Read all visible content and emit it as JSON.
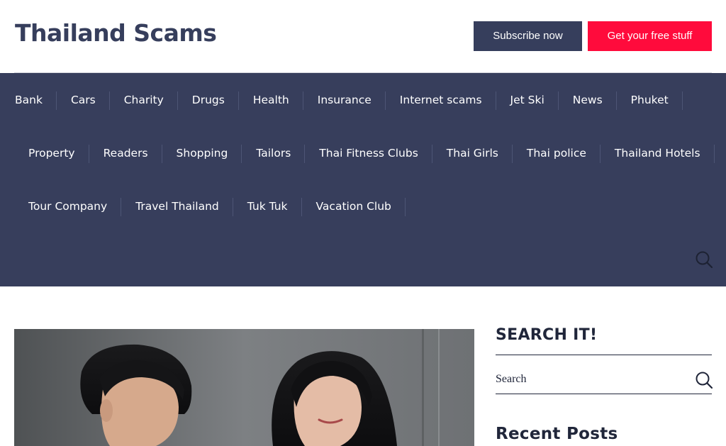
{
  "site": {
    "title": "Thailand Scams"
  },
  "header": {
    "subscribe_label": "Subscribe now",
    "free_label": "Get your free stuff"
  },
  "nav": {
    "rows": [
      [
        "Bank",
        "Cars",
        "Charity",
        "Drugs",
        "Health",
        "Insurance",
        "Internet scams",
        "Jet Ski",
        "News",
        "Phuket"
      ],
      [
        "Property",
        "Readers",
        "Shopping",
        "Tailors",
        "Thai Fitness Clubs",
        "Thai Girls",
        "Thai police",
        "Thailand Hotels"
      ],
      [
        "Tour Company",
        "Travel Thailand",
        "Tuk Tuk",
        "Vacation Club"
      ]
    ],
    "search_icon": "search-icon"
  },
  "sidebar": {
    "search_title": "SEARCH IT!",
    "search_placeholder": "Search",
    "recent_title": "Recent Posts"
  },
  "colors": {
    "nav_bg": "#373e5c",
    "subscribe_bg": "#363e5c",
    "free_bg": "#ff0b3c"
  }
}
